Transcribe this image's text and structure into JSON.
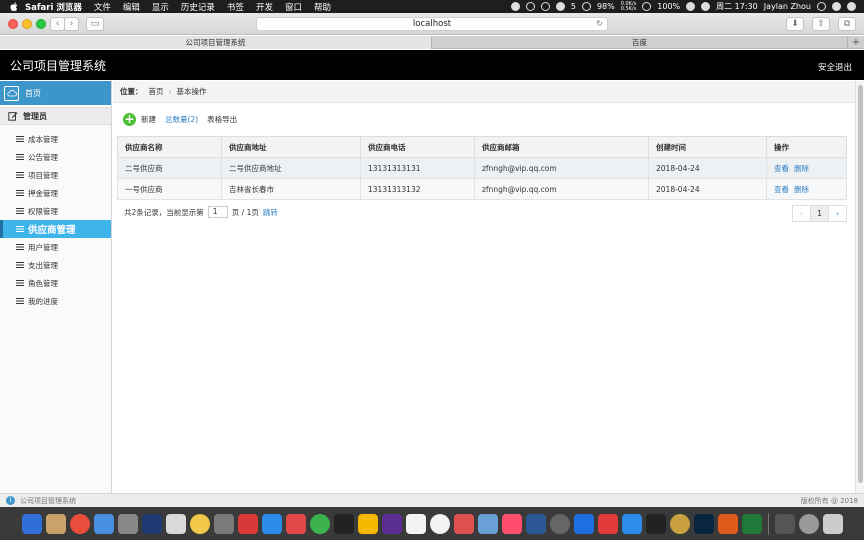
{
  "menubar": {
    "items": [
      "Safari 浏览器",
      "文件",
      "编辑",
      "显示",
      "历史记录",
      "书签",
      "开发",
      "窗口",
      "帮助"
    ],
    "status": {
      "notifications": "5",
      "net_up": "0.0K/s",
      "net_down": "0.5K/s",
      "cpu": "98%",
      "battery": "100%",
      "datetime": "周二 17:30",
      "user": "Jaylan Zhou"
    }
  },
  "browser": {
    "address": "localhost",
    "tabs": [
      "公司项目管理系统",
      "百度"
    ]
  },
  "app": {
    "title": "公司项目管理系统",
    "logout": "安全退出"
  },
  "sidebar": {
    "home": "首页",
    "section": "管理员",
    "items": [
      "成本管理",
      "公告管理",
      "项目管理",
      "押金管理",
      "权限管理",
      "供应商管理",
      "用户管理",
      "支出管理",
      "角色管理",
      "我的进度"
    ],
    "active_index": 5
  },
  "breadcrumb": {
    "label": "位置：",
    "home": "首页",
    "current": "基本操作"
  },
  "actions": {
    "new": "新建",
    "count": "总数量(2)",
    "export": "表格导出"
  },
  "table": {
    "headers": [
      "供应商名称",
      "供应商地址",
      "供应商电话",
      "供应商邮箱",
      "创建时间",
      "操作"
    ],
    "rows": [
      [
        "二号供应商",
        "二号供应商地址",
        "13131313131",
        "zfnngh@vip.qq.com",
        "2018-04-24"
      ],
      [
        "一号供应商",
        "吉林省长春市",
        "13131313132",
        "zfnngh@vip.qq.com",
        "2018-04-24"
      ]
    ],
    "op_view": "查看",
    "op_delete": "删除"
  },
  "pager": {
    "records": "共2条记录，",
    "current_label": "当前显示第",
    "page_value": "1",
    "total": "页 / 1页",
    "jump": "跳转",
    "prev": "‹",
    "page_num": "1",
    "next": "›"
  },
  "statusbar": {
    "left": "公司项目管理系统",
    "right": "版权所有 @ 2018"
  },
  "dock": {
    "colors": [
      "#2f6fd6",
      "#c8a26a",
      "#e94d3c",
      "#4a8ee0",
      "#888888",
      "#1f3a73",
      "#d9d9d9",
      "#f2c84b",
      "#7a7a7a",
      "#d93838",
      "#2b8be6",
      "#e04848",
      "#3cb34a",
      "#222222",
      "#f5b800",
      "#5a2d91",
      "#f2f2f2",
      "#f2f2f2",
      "#e05050",
      "#6aa0d8",
      "#ff4d6d",
      "#2b5797",
      "#666666",
      "#1e6fe0",
      "#e23b3b",
      "#2d8ceb",
      "#222222",
      "#c8a040",
      "#0a2540",
      "#e05a1c",
      "#1f7a3a",
      "#555555",
      "#999999",
      "#cccccc"
    ]
  }
}
